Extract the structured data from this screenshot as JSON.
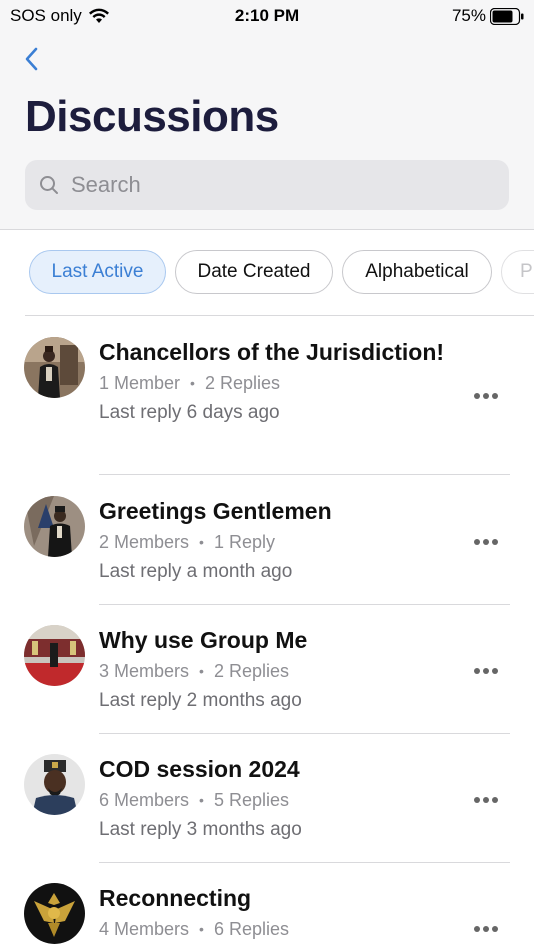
{
  "status_bar": {
    "carrier": "SOS only",
    "time": "2:10 PM",
    "battery": "75%"
  },
  "header": {
    "title": "Discussions"
  },
  "search": {
    "placeholder": "Search"
  },
  "filters": [
    {
      "label": "Last Active",
      "active": true
    },
    {
      "label": "Date Created",
      "active": false
    },
    {
      "label": "Alphabetical",
      "active": false
    },
    {
      "label": "P",
      "active": false
    }
  ],
  "discussions": [
    {
      "title": "Chancellors of the Jurisdiction!",
      "members": "1 Member",
      "replies": "2 Replies",
      "last_reply": "Last reply 6 days ago"
    },
    {
      "title": "Greetings Gentlemen",
      "members": "2 Members",
      "replies": "1 Reply",
      "last_reply": "Last reply a month ago"
    },
    {
      "title": "Why use Group Me",
      "members": "3 Members",
      "replies": "2 Replies",
      "last_reply": "Last reply 2 months ago"
    },
    {
      "title": "COD session 2024",
      "members": "6 Members",
      "replies": "5 Replies",
      "last_reply": "Last reply 3 months ago"
    },
    {
      "title": "Reconnecting",
      "members": "4 Members",
      "replies": "6 Replies",
      "last_reply": ""
    }
  ],
  "colors": {
    "accent": "#3b7fd4",
    "title": "#1d1d3d",
    "muted": "#8e8e93"
  }
}
